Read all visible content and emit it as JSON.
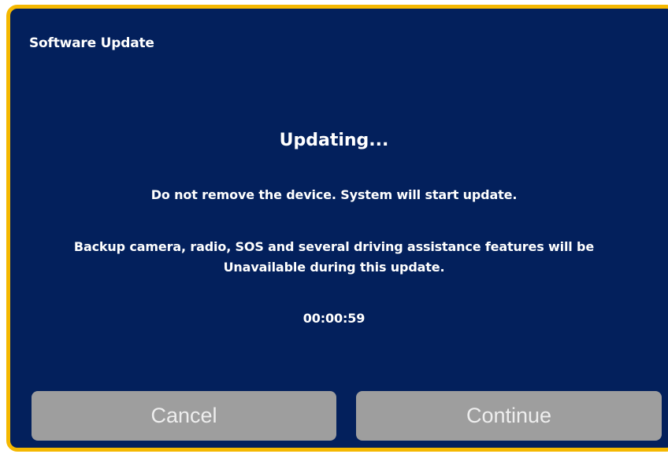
{
  "dialog": {
    "title": "Software Update",
    "heading": "Updating...",
    "message_1": "Do not remove the device. System will start update.",
    "message_2_line1": "Backup camera, radio, SOS and several driving assistance features will be",
    "message_2_line2": "Unavailable during this update.",
    "timer": "00:00:59"
  },
  "buttons": {
    "cancel_label": "Cancel",
    "continue_label": "Continue"
  },
  "colors": {
    "background": "#03205c",
    "border": "#f5b800",
    "button": "#9e9e9e",
    "text": "#ffffff"
  }
}
